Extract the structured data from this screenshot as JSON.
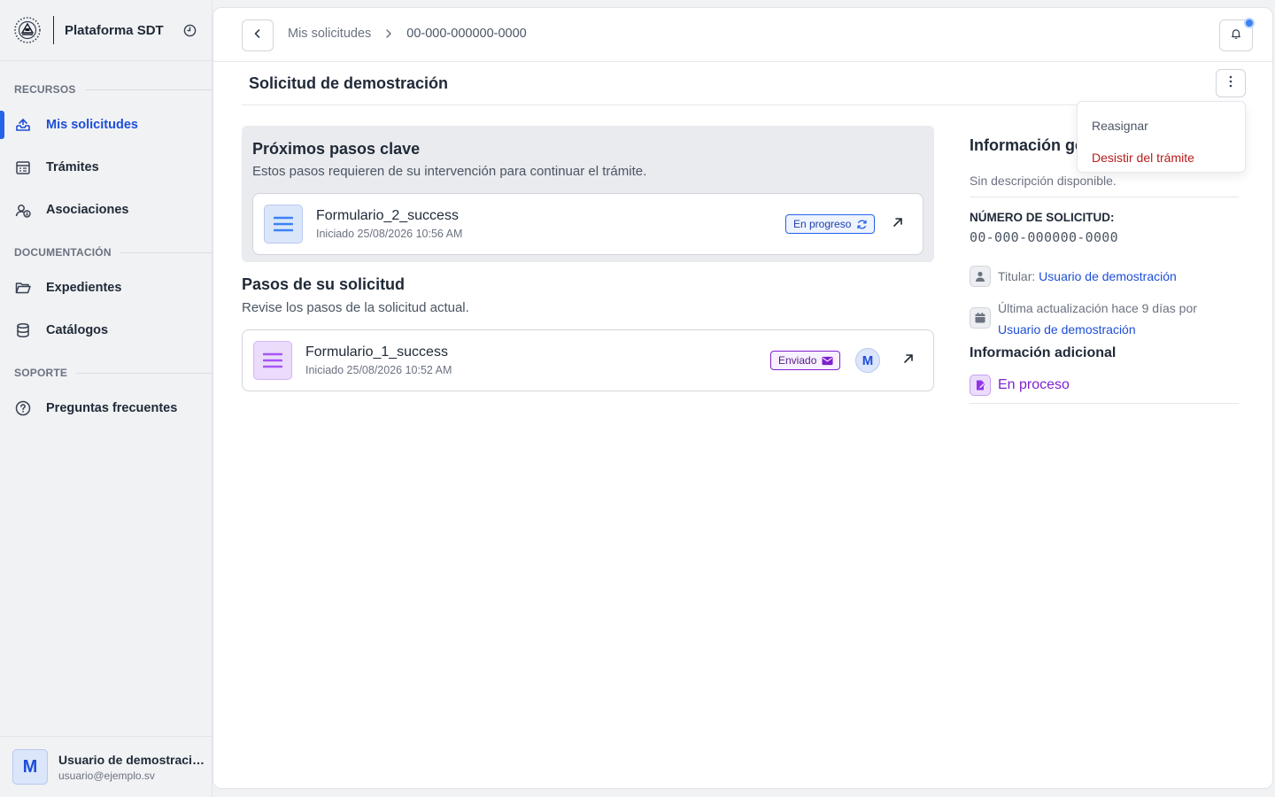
{
  "sidebar": {
    "brand_title": "Plataforma SDT",
    "sections": [
      {
        "label": "RECURSOS"
      },
      {
        "label": "DOCUMENTACIÓN"
      },
      {
        "label": "SOPORTE"
      }
    ],
    "items": [
      {
        "label": "Mis solicitudes",
        "icon": "inbox-icon",
        "active": true
      },
      {
        "label": "Trámites",
        "icon": "calendar-list-icon"
      },
      {
        "label": "Asociaciones",
        "icon": "user-group-icon"
      },
      {
        "label": "Expedientes",
        "icon": "folder-icon"
      },
      {
        "label": "Catálogos",
        "icon": "database-icon"
      },
      {
        "label": "Preguntas frecuentes",
        "icon": "question-circle-icon"
      }
    ],
    "user": {
      "initial": "M",
      "name": "Usuario de demostraci…",
      "email": "usuario@ejemplo.sv"
    }
  },
  "breadcrumb": {
    "parent": "Mis solicitudes",
    "current": "00-000-000000-0000"
  },
  "page": {
    "title": "Solicitud de demostración"
  },
  "menu": {
    "reassign": "Reasignar",
    "withdraw": "Desistir del trámite"
  },
  "key_steps": {
    "title": "Próximos pasos clave",
    "subtitle": "Estos pasos requieren de su intervención para continuar el trámite.",
    "card": {
      "name": "Formulario_2_success",
      "date": "Iniciado 25/08/2026 10:56 AM",
      "status": "En progreso"
    }
  },
  "steps": {
    "title": "Pasos de su solicitud",
    "subtitle": "Revise los pasos de la solicitud actual.",
    "card": {
      "name": "Formulario_1_success",
      "date": "Iniciado 25/08/2026 10:52 AM",
      "status": "Enviado",
      "assignee_initial": "M"
    }
  },
  "info": {
    "title": "Información general",
    "description": "Sin descripción disponible.",
    "number_label": "NÚMERO DE SOLICITUD:",
    "number_value": "00-000-000000-0000",
    "owner_label": "Titular:",
    "owner_name": "Usuario de demostración",
    "updated_text": "Última actualización hace 9 días por",
    "updated_by": "Usuario de demostración",
    "additional_title": "Información adicional",
    "status": "En proceso"
  },
  "colors": {
    "accent": "#2563eb",
    "danger": "#b91c1c",
    "purple": "#7e22ce"
  }
}
